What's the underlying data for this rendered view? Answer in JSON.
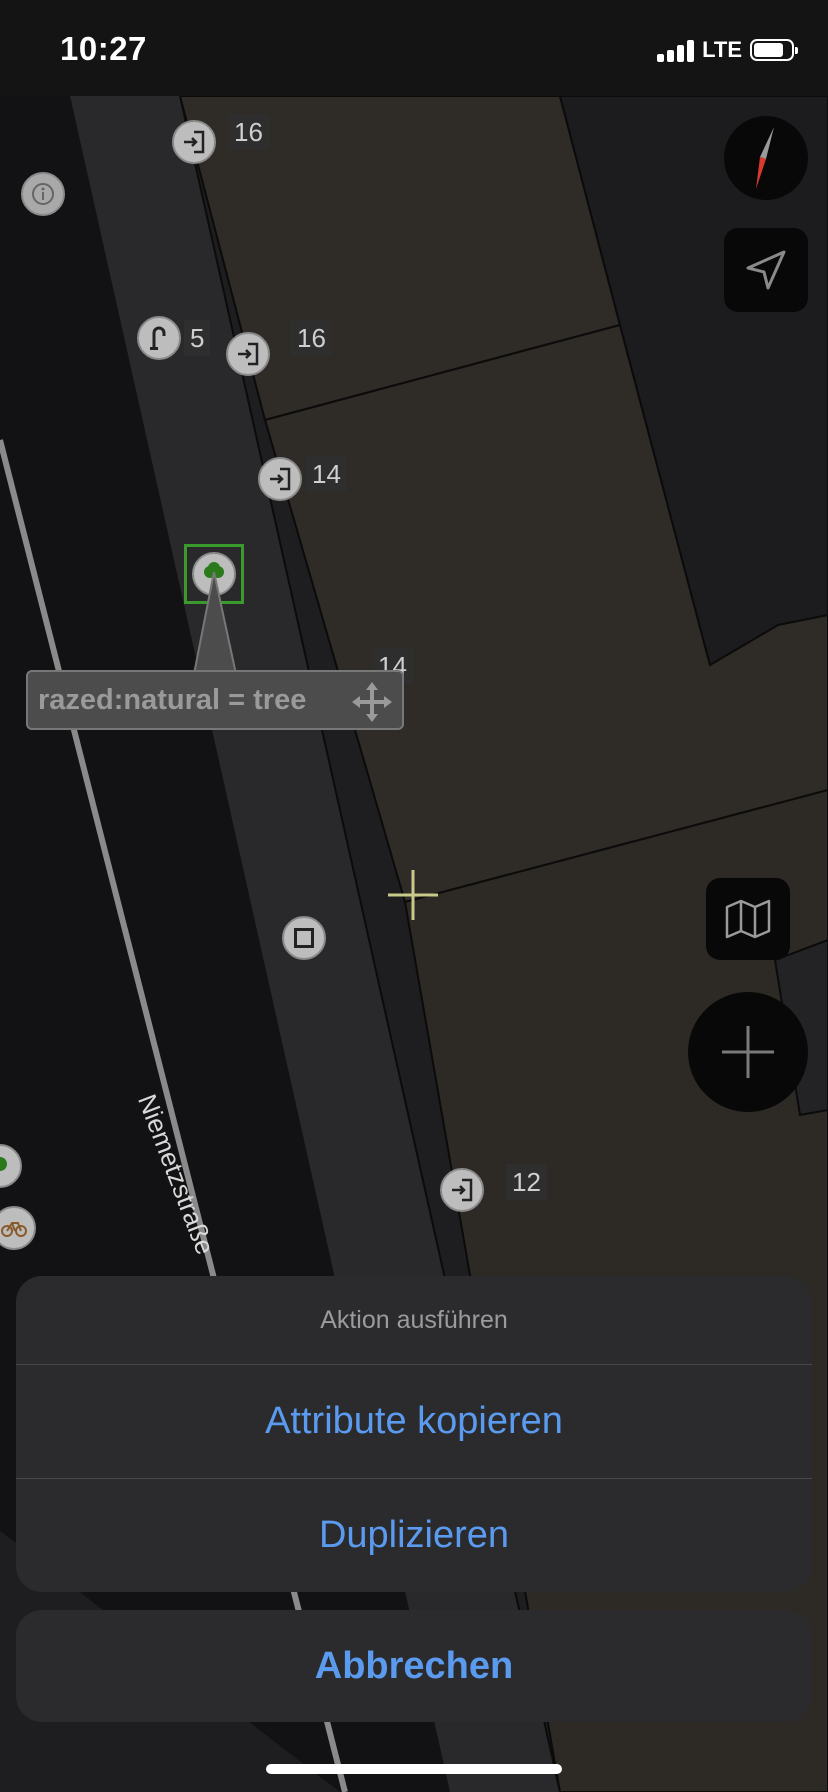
{
  "status_bar": {
    "time": "10:27",
    "network": "LTE"
  },
  "map": {
    "street_name": "Niemetzstraße",
    "house_numbers": [
      "16",
      "5",
      "16",
      "14",
      "14",
      "12"
    ],
    "selected_tag_label": "razed:natural = tree"
  },
  "icons": {
    "info": "info-icon",
    "entrance": "entrance-icon",
    "tree": "tree-icon",
    "compass": "compass-icon",
    "locate": "location-arrow-icon",
    "layers": "map-layers-icon",
    "add": "plus-icon",
    "move": "move-arrows-icon"
  },
  "action_sheet": {
    "title": "Aktion ausführen",
    "actions": [
      "Attribute kopieren",
      "Duplizieren"
    ],
    "cancel_label": "Abbrechen"
  },
  "colors": {
    "accent": "#5b9bef",
    "selection": "#3a9a2c"
  }
}
